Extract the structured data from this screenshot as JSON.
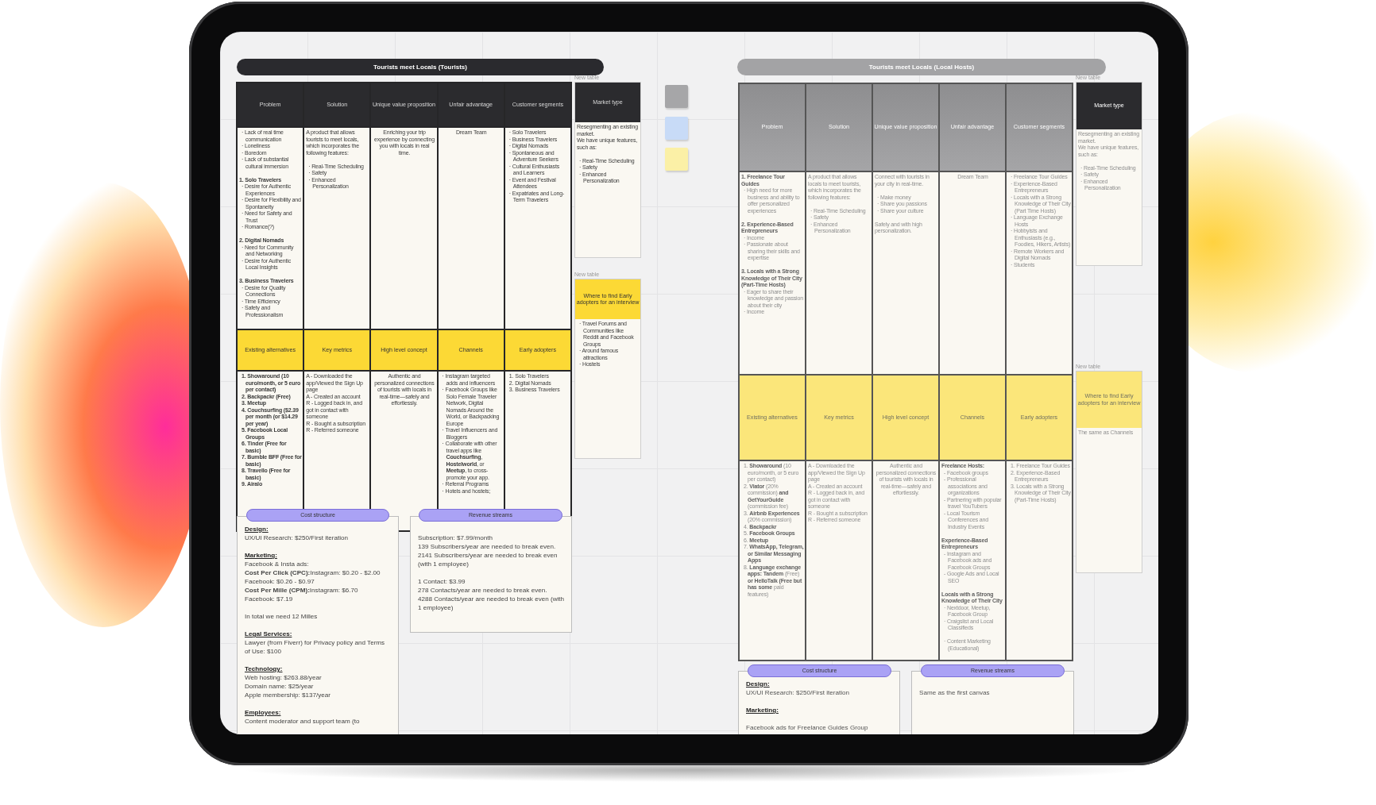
{
  "canvases": [
    {
      "title": "Tourists meet Locals (Tourists)",
      "faded": false,
      "top_headers": [
        "Problem",
        "Solution",
        "Unique value proposition",
        "Unfair advantage",
        "Customer segments"
      ],
      "top_cells": [
        {
          "lines": [
            {
              "kind": "item",
              "text": "· Lack of real time communication"
            },
            {
              "kind": "item",
              "text": "· Loneliness"
            },
            {
              "kind": "item",
              "text": "· Boredom"
            },
            {
              "kind": "item",
              "text": "· Lack of substantial cultural immersion"
            },
            {
              "kind": "text",
              "bold": true,
              "gap": true,
              "text": "1. Solo Travelers"
            },
            {
              "kind": "item",
              "text": "· Desire for Authentic Experiences"
            },
            {
              "kind": "item",
              "text": "· Desire for Flexibility and Spontaneity"
            },
            {
              "kind": "item",
              "text": "· Need for Safety and Trust"
            },
            {
              "kind": "item",
              "text": "· Romance(?)"
            },
            {
              "kind": "text",
              "bold": true,
              "gap": true,
              "text": "2. Digital Nomads"
            },
            {
              "kind": "item",
              "text": "· Need for Community and Networking"
            },
            {
              "kind": "item",
              "text": "· Desire for Authentic Local Insights"
            },
            {
              "kind": "text",
              "bold": true,
              "gap": true,
              "text": "3. Business Travelers"
            },
            {
              "kind": "item",
              "text": "· Desire for Quality Connections"
            },
            {
              "kind": "item",
              "text": "· Time Efficiency"
            },
            {
              "kind": "item",
              "text": "· Safety and Professionalism"
            }
          ]
        },
        {
          "lines": [
            {
              "kind": "text",
              "text": "A product that allows tourists to meet locals, which incorporates the following features:"
            },
            {
              "kind": "item",
              "gap": true,
              "text": "· Real-Time Scheduling"
            },
            {
              "kind": "item",
              "text": "· Safety"
            },
            {
              "kind": "item",
              "text": "· Enhanced Personalization"
            }
          ]
        },
        {
          "centered": true,
          "lines": [
            {
              "kind": "text",
              "text": "Enriching your trip experience by connecting you with locals in real time."
            }
          ]
        },
        {
          "centered": true,
          "lines": [
            {
              "kind": "text",
              "text": "Dream Team"
            }
          ]
        },
        {
          "lines": [
            {
              "kind": "item",
              "text": "· Solo Travelers"
            },
            {
              "kind": "item",
              "text": "· Business Travelers"
            },
            {
              "kind": "item",
              "text": "· Digital Nomads"
            },
            {
              "kind": "item",
              "text": "· Spontaneous and Adventure Seekers"
            },
            {
              "kind": "item",
              "text": "· Cultural Enthusiasts and Learners"
            },
            {
              "kind": "item",
              "text": "· Event and Festival Attendees"
            },
            {
              "kind": "item",
              "text": "· Expatriates and Long-Term Travelers"
            }
          ]
        }
      ],
      "bottom_headers": [
        "Existing alternatives",
        "Key metrics",
        "High level concept",
        "Channels",
        "Early adopters"
      ],
      "bottom_cells": [
        {
          "lines": [
            {
              "kind": "item",
              "bold": true,
              "text": "1. Showaround (10 euro/month, or 5 euro per contact)"
            },
            {
              "kind": "item",
              "bold": true,
              "text": "2. Backpackr (Free)"
            },
            {
              "kind": "item",
              "bold": true,
              "text": "3. Meetup"
            },
            {
              "kind": "item",
              "bold": true,
              "text": "4. Couchsurfing ($2.39 per month (or $14.29 per year)"
            },
            {
              "kind": "item",
              "bold": true,
              "text": "5. Facebook Local Groups"
            },
            {
              "kind": "item",
              "bold": true,
              "text": "6. Tinder (Free for basic)"
            },
            {
              "kind": "item",
              "bold": true,
              "text": "7. Bumble BFF (Free for basic)"
            },
            {
              "kind": "item",
              "bold": true,
              "text": "8. Travello (Free for basic)"
            },
            {
              "kind": "item",
              "bold": true,
              "text": "9. Airalo"
            }
          ]
        },
        {
          "lines": [
            {
              "kind": "text",
              "text": "A - Downloaded the app/Viewed the Sign Up page"
            },
            {
              "kind": "text",
              "text": "A - Created an account"
            },
            {
              "kind": "text",
              "text": "R - Logged back in, and got in contact with someone"
            },
            {
              "kind": "text",
              "text": "R - Bought a subscription"
            },
            {
              "kind": "text",
              "text": "R - Referred someone"
            }
          ]
        },
        {
          "centered": true,
          "lines": [
            {
              "kind": "text",
              "text": "Authentic and personalized connections of tourists with locals in real-time—safely and effortlessly."
            }
          ]
        },
        {
          "lines": [
            {
              "kind": "item",
              "text": "· Instagram targeted adds and influencers"
            },
            {
              "kind": "item",
              "text": "· Facebook Groups like Solo Female Traveler Network, Digital Nomads Around the World, or Backpacking Europe"
            },
            {
              "kind": "item",
              "text": "· Travel Influencers and Bloggers"
            },
            {
              "kind": "item",
              "text": "· Collaborate with other travel apps like **Couchsurfing**, **Hostelworld**, or **Meetup**, to cross-promote your app."
            },
            {
              "kind": "item",
              "text": "· Referral Programs"
            },
            {
              "kind": "item",
              "text": "· Hotels and hostels;"
            }
          ]
        },
        {
          "lines": [
            {
              "kind": "item",
              "text": "1. Solo Travelers"
            },
            {
              "kind": "item",
              "text": "2. Digital Nomads"
            },
            {
              "kind": "item",
              "text": "3. Business Travelers"
            }
          ]
        }
      ],
      "market_type": {
        "caption": "New table",
        "header": "Market type",
        "lines": [
          {
            "kind": "text",
            "text": "Resegmenting an existing market."
          },
          {
            "kind": "text",
            "text": "We have unique features, such as:"
          },
          {
            "kind": "item",
            "gap": true,
            "text": "· Real-Time Scheduling"
          },
          {
            "kind": "item",
            "text": "· Safety"
          },
          {
            "kind": "item",
            "text": "· Enhanced Personalization"
          }
        ]
      },
      "side_note": {
        "caption": "New table",
        "header": "Where to find Early adopters for an interview",
        "lines": [
          {
            "kind": "item",
            "text": "· Travel Forums and Communities like Reddit and Facebook Groups"
          },
          {
            "kind": "item",
            "text": "· Around famous attractions"
          },
          {
            "kind": "item",
            "text": "· Hostels"
          }
        ]
      },
      "cost_structure": {
        "label": "Cost structure",
        "lines": [
          {
            "kind": "section",
            "text": "Design:"
          },
          {
            "kind": "text",
            "text": "UX/UI Research: $250/First iteration"
          },
          {
            "kind": "section",
            "gap": true,
            "text": "Marketing:"
          },
          {
            "kind": "text",
            "text": "Facebook & Insta ads:"
          },
          {
            "kind": "text",
            "text": "**Cost Per Click (CPC):**Instagram: $0.20 - $2.00"
          },
          {
            "kind": "text",
            "text": "Facebook: $0.26 - $0.97"
          },
          {
            "kind": "text",
            "text": "**Cost Per Mille (CPM):**Instagram: $6.70"
          },
          {
            "kind": "text",
            "text": "Facebook: $7.19"
          },
          {
            "kind": "text",
            "gap": true,
            "text": "In total we need 12 Milles"
          },
          {
            "kind": "section",
            "gap": true,
            "text": "Legal Services:"
          },
          {
            "kind": "text",
            "text": "Lawyer (from Fiverr) for Privacy policy and Terms of Use: $100"
          },
          {
            "kind": "section",
            "gap": true,
            "text": "Technology:"
          },
          {
            "kind": "text",
            "text": "Web hosting: $263.88/year"
          },
          {
            "kind": "text",
            "text": "Domain name: $25/year"
          },
          {
            "kind": "text",
            "text": "Apple membership: $137/year"
          },
          {
            "kind": "section",
            "gap": true,
            "text": "Employees:"
          },
          {
            "kind": "text",
            "text": "Content moderator and support team (to"
          }
        ]
      },
      "revenue_streams": {
        "label": "Revenue streams",
        "lines": [
          {
            "kind": "text",
            "gap": true,
            "text": "Subscription: $7.99/month"
          },
          {
            "kind": "text",
            "text": "139 Subscribers/year are needed to break even."
          },
          {
            "kind": "text",
            "text": "2141 Subscribers/year are needed to break even (with 1 employee)"
          },
          {
            "kind": "text",
            "gap": true,
            "text": "1 Contact: $3.99"
          },
          {
            "kind": "text",
            "text": "278 Contacts/year are needed to break even."
          },
          {
            "kind": "text",
            "text": "4288 Contacts/year are needed to break even (with 1 employee)"
          }
        ]
      }
    },
    {
      "title": "Tourists meet Locals (Local Hosts)",
      "faded": true,
      "top_headers": [
        "Problem",
        "Solution",
        "Unique value proposition",
        "Unfair advantage",
        "Customer segments"
      ],
      "top_cells": [
        {
          "lines": [
            {
              "kind": "text",
              "bold": true,
              "text": "1. Freelance Tour Guides"
            },
            {
              "kind": "item",
              "text": "· High need for more business and ability to offer personalized experiences"
            },
            {
              "kind": "text",
              "bold": true,
              "gap": true,
              "text": "2. Experience-Based Entrepreneurs"
            },
            {
              "kind": "item",
              "text": "· Income"
            },
            {
              "kind": "item",
              "text": "· Passionate about sharing their skills and expertise"
            },
            {
              "kind": "text",
              "bold": true,
              "gap": true,
              "text": "3. Locals with a Strong Knowledge of Their City (Part-Time Hosts)"
            },
            {
              "kind": "item",
              "text": "· Eager to share their knowledge and passion about their city"
            },
            {
              "kind": "item",
              "text": "· Income"
            }
          ]
        },
        {
          "lines": [
            {
              "kind": "text",
              "text": "A product that allows locals to meet tourists, which incorporates the following features:"
            },
            {
              "kind": "item",
              "gap": true,
              "text": "· Real-Time Scheduling"
            },
            {
              "kind": "item",
              "text": "· Safety"
            },
            {
              "kind": "item",
              "text": "· Enhanced Personalization"
            }
          ]
        },
        {
          "lines": [
            {
              "kind": "text",
              "text": "Connect with tourists in your city in real-time."
            },
            {
              "kind": "item",
              "gap": true,
              "text": "· Make money"
            },
            {
              "kind": "item",
              "text": "· Share you passions"
            },
            {
              "kind": "item",
              "text": "· Share your culture"
            },
            {
              "kind": "text",
              "gap": true,
              "text": "Safely and with high personalization."
            }
          ]
        },
        {
          "centered": true,
          "lines": [
            {
              "kind": "text",
              "text": "Dream Team"
            }
          ]
        },
        {
          "lines": [
            {
              "kind": "item",
              "text": "· Freelance Tour Guides"
            },
            {
              "kind": "item",
              "text": "· Experience-Based Entrepreneurs"
            },
            {
              "kind": "item",
              "text": "· Locals with a Strong Knowledge of Their City (Part Time Hosts)"
            },
            {
              "kind": "item",
              "text": "· Language Exchange Hosts"
            },
            {
              "kind": "item",
              "text": "· Hobbyists and Enthusiasts (e.g., Foodies, Hikers, Artists)"
            },
            {
              "kind": "item",
              "text": "· Remote Workers and Digital Nomads"
            },
            {
              "kind": "item",
              "text": "· Students"
            }
          ]
        }
      ],
      "bottom_headers": [
        "Existing alternatives",
        "Key metrics",
        "High level concept",
        "Channels",
        "Early adopters"
      ],
      "bottom_cells": [
        {
          "lines": [
            {
              "kind": "item",
              "text": "1. **Showaround** (10 euro/month, or 5 euro per contact)"
            },
            {
              "kind": "item",
              "text": "2. **Viator** (20% commission) **and GetYourGuide** (commission fee)"
            },
            {
              "kind": "item",
              "text": "3. **Airbnb Experiences** (20% commission)"
            },
            {
              "kind": "item",
              "text": "4. **Backpackr**"
            },
            {
              "kind": "item",
              "text": "5. **Facebook Groups**"
            },
            {
              "kind": "item",
              "text": "6. **Meetup**"
            },
            {
              "kind": "item",
              "text": "7. **WhatsApp, Telegram, or Similar Messaging Apps**"
            },
            {
              "kind": "item",
              "text": "8. **Language exchange apps: Tandem** (Free) **or HelloTalk (Free but has some** paid features)"
            }
          ]
        },
        {
          "lines": [
            {
              "kind": "text",
              "text": "A - Downloaded the app/Viewed the Sign Up page"
            },
            {
              "kind": "text",
              "text": "A - Created an account"
            },
            {
              "kind": "text",
              "text": "R - Logged back in, and got in contact with someone"
            },
            {
              "kind": "text",
              "text": "R - Bought a subscription"
            },
            {
              "kind": "text",
              "text": "R - Referred someone"
            }
          ]
        },
        {
          "centered": true,
          "lines": [
            {
              "kind": "text",
              "text": "Authentic and personalized connections of tourists with locals in real-time—safely and effortlessly."
            }
          ]
        },
        {
          "lines": [
            {
              "kind": "text",
              "bold": true,
              "text": "Freelance Hosts:"
            },
            {
              "kind": "item",
              "text": "- Facebook groups"
            },
            {
              "kind": "item",
              "text": "- Professional associations and organizations"
            },
            {
              "kind": "item",
              "text": "- Partnering with popular travel YouTubers"
            },
            {
              "kind": "item",
              "text": "- Local Tourism Conferences and Industry Events"
            },
            {
              "kind": "text",
              "bold": true,
              "gap": true,
              "text": "Experience-Based Entrepreneurs"
            },
            {
              "kind": "item",
              "text": "- Instagram and Facebook ads and Facebook Groups"
            },
            {
              "kind": "item",
              "text": "- Google Ads and Local SEO"
            },
            {
              "kind": "text",
              "bold": true,
              "gap": true,
              "text": "Locals with a Strong Knowledge of Their City"
            },
            {
              "kind": "item",
              "text": "· Nextdoor, Meetup, Facebook Group"
            },
            {
              "kind": "item",
              "text": "· Craigslist and Local Classifieds"
            },
            {
              "kind": "item",
              "gap": true,
              "text": "· Content Marketing (Educational)"
            }
          ]
        },
        {
          "lines": [
            {
              "kind": "item",
              "text": "1. Freelance Tour Guides"
            },
            {
              "kind": "item",
              "text": "2. Experience-Based Entrepreneurs"
            },
            {
              "kind": "item",
              "text": "3. Locals with a Strong Knowledge of Their City (Part-Time Hosts)"
            }
          ]
        }
      ],
      "market_type": {
        "caption": "New table",
        "header": "Market type",
        "lines": [
          {
            "kind": "text",
            "text": "Resegmenting an existing market."
          },
          {
            "kind": "text",
            "text": "We have unique features, such as:"
          },
          {
            "kind": "item",
            "gap": true,
            "text": "· Real-Time Scheduling"
          },
          {
            "kind": "item",
            "text": "· Safety"
          },
          {
            "kind": "item",
            "text": "· Enhanced Personalization"
          }
        ]
      },
      "side_note": {
        "caption": "New table",
        "header": "Where to find Early adopters for an interview",
        "lines": [
          {
            "kind": "text",
            "text": "The same as Channels"
          }
        ]
      },
      "cost_structure": {
        "label": "Cost structure",
        "lines": [
          {
            "kind": "section",
            "text": "Design:"
          },
          {
            "kind": "text",
            "text": "UX/UI Research: $250/First iteration"
          },
          {
            "kind": "section",
            "gap": true,
            "text": "Marketing:"
          },
          {
            "kind": "text",
            "gap": true,
            "text": "Facebook ads for Freelance Guides Group"
          }
        ]
      },
      "revenue_streams": {
        "label": "Revenue streams",
        "lines": [
          {
            "kind": "text",
            "gap": true,
            "text": "Same as the first canvas"
          }
        ]
      }
    }
  ],
  "sticky_notes": [
    {
      "color": "#a6a6a8"
    },
    {
      "color": "#c8dbf7"
    },
    {
      "color": "#fbf0a6"
    }
  ]
}
